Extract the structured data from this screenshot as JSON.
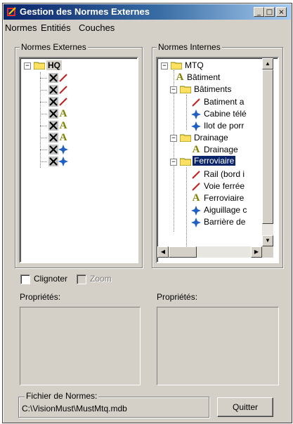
{
  "window": {
    "title": "Gestion des Normes Externes",
    "controls": {
      "minimize": "_",
      "maximize": "□",
      "close": "×"
    }
  },
  "menu": {
    "items": [
      "Normes",
      "Entitiés",
      "Couches"
    ]
  },
  "left_group": {
    "label": "Normes Externes",
    "root": "HQ",
    "children": [
      {
        "icon": "line-icon"
      },
      {
        "icon": "line-icon"
      },
      {
        "icon": "line-icon"
      },
      {
        "icon": "text-icon"
      },
      {
        "icon": "text-icon"
      },
      {
        "icon": "text-icon"
      },
      {
        "icon": "point-icon"
      },
      {
        "icon": "point-icon"
      }
    ]
  },
  "right_group": {
    "label": "Normes Internes",
    "root": "MTQ",
    "items": [
      {
        "label": "Bâtiment",
        "icon": "text-icon"
      },
      {
        "label": "Bâtiments",
        "icon": "folder-icon"
      },
      {
        "label": "Batiment a",
        "icon": "line-icon"
      },
      {
        "label": "Cabine télé",
        "icon": "point-icon"
      },
      {
        "label": "Ilot de porr",
        "icon": "point-icon"
      },
      {
        "label": "Drainage",
        "icon": "folder-icon"
      },
      {
        "label": "Drainage",
        "icon": "text-icon"
      },
      {
        "label": "Ferroviaire",
        "icon": "folder-icon"
      },
      {
        "label": "Rail (bord i",
        "icon": "line-icon"
      },
      {
        "label": "Voie ferrée",
        "icon": "line-icon"
      },
      {
        "label": "Ferroviaire",
        "icon": "text-icon"
      },
      {
        "label": "Aiguillage c",
        "icon": "point-icon"
      },
      {
        "label": "Barrière de",
        "icon": "point-icon"
      }
    ]
  },
  "options": {
    "clignoter": "Clignoter",
    "zoom": "Zoom"
  },
  "properties": {
    "left_label": "Propriétés:",
    "right_label": "Propriétés:"
  },
  "file": {
    "label": "Fichier de Normes:",
    "path": "C:\\VisionMust\\MustMtq.mdb"
  },
  "quit_button": "Quitter",
  "colors": {
    "title_start": "#0a246a",
    "title_end": "#a6caf0",
    "selection": "#0a246a",
    "face": "#d4d0c8"
  }
}
